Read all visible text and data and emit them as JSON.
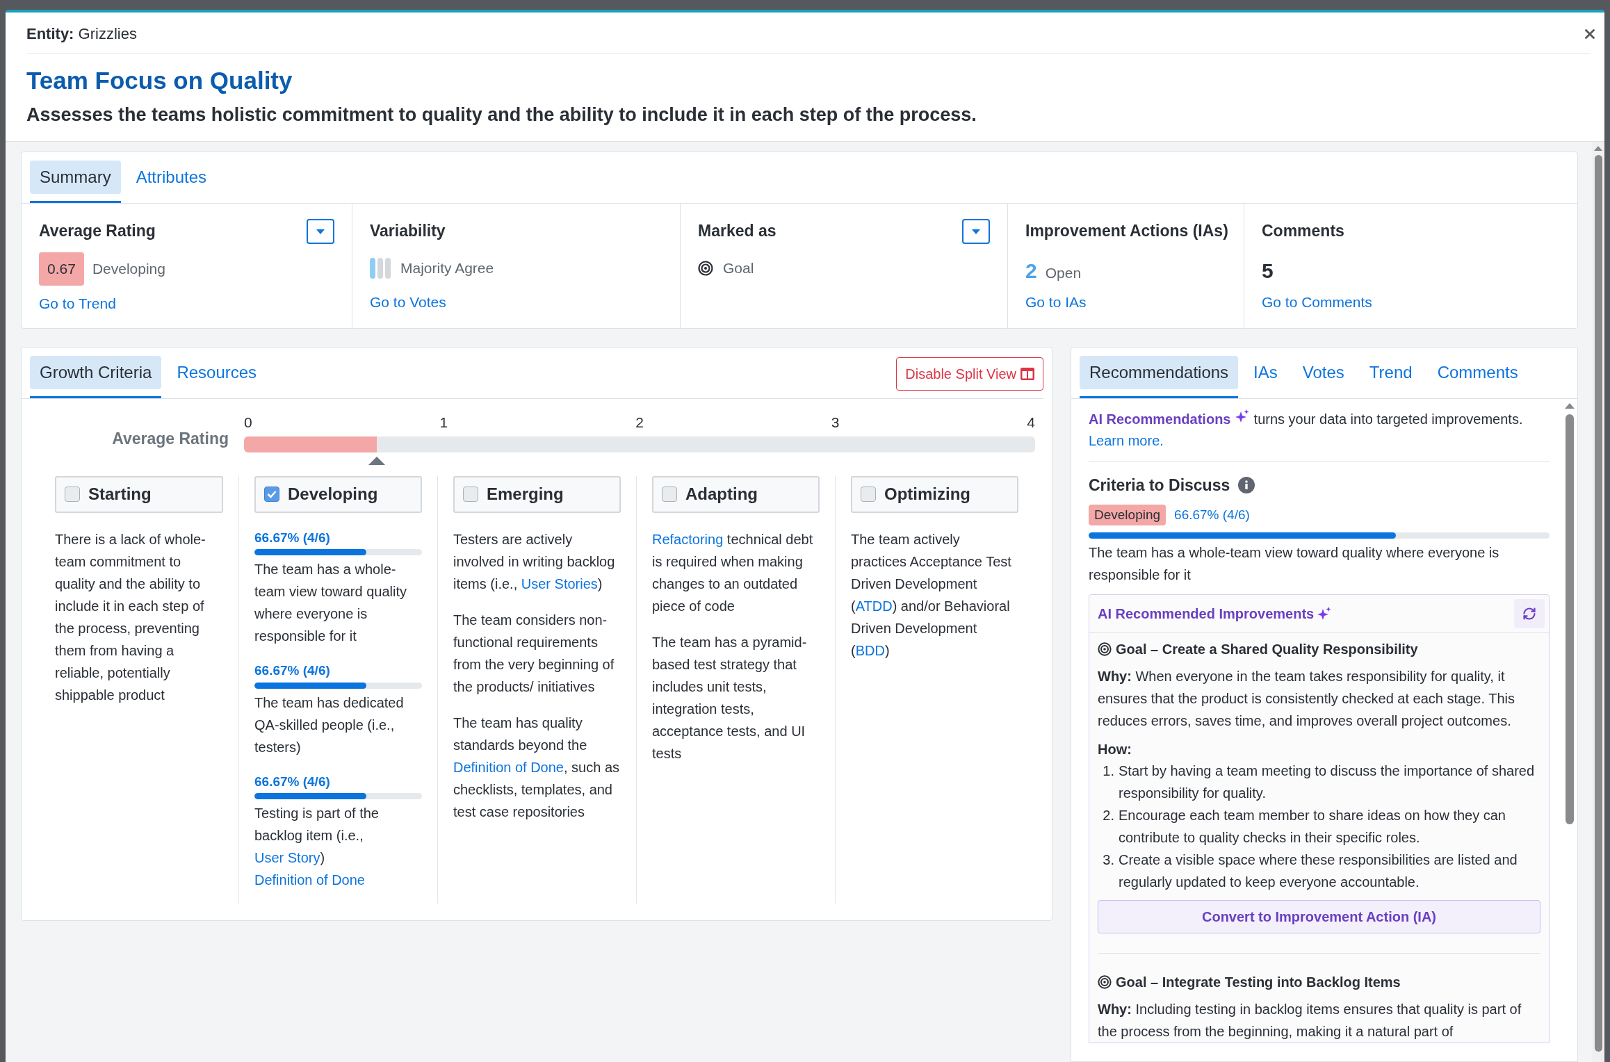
{
  "entity": {
    "label": "Entity:",
    "value": "Grizzlies"
  },
  "title": "Team Focus on Quality",
  "description": "Assesses the teams holistic commitment to quality and the ability to include it in each step of the process.",
  "summary_tabs": [
    {
      "label": "Summary",
      "selected": true
    },
    {
      "label": "Attributes",
      "selected": false
    }
  ],
  "summary_cards": [
    {
      "kind": "rating",
      "label": "Average Rating",
      "dropdown": true,
      "value": "0.67",
      "status": "Developing",
      "color": "#f4a7a7",
      "link": "Go to Trend"
    },
    {
      "kind": "variability",
      "label": "Variability",
      "dropdown": false,
      "status": "Majority Agree",
      "link": "Go to Votes"
    },
    {
      "kind": "marker",
      "label": "Marked as",
      "dropdown": true,
      "status": "Goal"
    },
    {
      "kind": "count",
      "label": "Improvement Actions (IAs)",
      "dropdown": false,
      "value": "2",
      "status": "Open",
      "link": "Go to IAs"
    },
    {
      "kind": "count",
      "label": "Comments",
      "dropdown": false,
      "value": "5",
      "link": "Go to Comments"
    }
  ],
  "growth_tabs": [
    {
      "label": "Growth Criteria",
      "selected": true
    },
    {
      "label": "Resources",
      "selected": false
    }
  ],
  "split_view_button": "Disable Split View",
  "rating_scale": {
    "label": "Average Rating",
    "ticks": [
      "0",
      "1",
      "2",
      "3",
      "4"
    ],
    "level": 0.1675
  },
  "levels": [
    {
      "name": "Starting",
      "checked": false,
      "criteria": [
        {
          "parts": [
            {
              "text": "There is a lack of whole-team commitment to quality and the ability to include it in each step of the process, preventing them from having a reliable, potentially shippable product",
              "link": false
            }
          ]
        }
      ]
    },
    {
      "name": "Developing",
      "checked": true,
      "criteria": [
        {
          "progress": {
            "label": "66.67% (4/6)",
            "level": 0.6667
          },
          "parts": [
            {
              "text": "The team has a whole-team view toward quality where everyone is responsible for it",
              "link": false
            }
          ]
        },
        {
          "progress": {
            "label": "66.67% (4/6)",
            "level": 0.6667
          },
          "parts": [
            {
              "text": "The team has dedicated QA-skilled people (i.e., testers)",
              "link": false
            }
          ]
        },
        {
          "progress": {
            "label": "66.67% (4/6)",
            "level": 0.6667
          },
          "parts": [
            {
              "text": "Testing is part of the backlog item (i.e., ",
              "link": false
            },
            {
              "text": "User Story",
              "link": true
            },
            {
              "text": ") ",
              "link": false
            },
            {
              "text": "Definition of Done",
              "link": true
            }
          ]
        }
      ]
    },
    {
      "name": "Emerging",
      "checked": false,
      "criteria": [
        {
          "parts": [
            {
              "text": "Testers are actively involved in writing backlog items (i.e., ",
              "link": false
            },
            {
              "text": "User Stories",
              "link": true
            },
            {
              "text": ")",
              "link": false
            }
          ]
        },
        {
          "parts": [
            {
              "text": "The team considers non-functional requirements from the very beginning of the products/ initiatives",
              "link": false
            }
          ]
        },
        {
          "parts": [
            {
              "text": "The team has quality standards beyond the ",
              "link": false
            },
            {
              "text": "Definition of Done",
              "link": true
            },
            {
              "text": ", such as checklists, templates, and test case repositories",
              "link": false
            }
          ]
        }
      ]
    },
    {
      "name": "Adapting",
      "checked": false,
      "criteria": [
        {
          "parts": [
            {
              "text": "Refactoring",
              "link": true
            },
            {
              "text": " technical debt is required when making changes to an outdated piece of code",
              "link": false
            }
          ]
        },
        {
          "parts": [
            {
              "text": "The team has a pyramid-based test strategy that includes unit tests, integration tests, acceptance tests, and UI tests",
              "link": false
            }
          ]
        }
      ]
    },
    {
      "name": "Optimizing",
      "checked": false,
      "criteria": [
        {
          "parts": [
            {
              "text": "The team actively practices Acceptance Test Driven Development (",
              "link": false
            },
            {
              "text": "ATDD",
              "link": true
            },
            {
              "text": ") and/or Behavioral Driven Development (",
              "link": false
            },
            {
              "text": "BDD",
              "link": true
            },
            {
              "text": ")",
              "link": false
            }
          ]
        }
      ]
    }
  ],
  "side_tabs": [
    {
      "label": "Recommendations",
      "selected": true
    },
    {
      "label": "IAs",
      "selected": false
    },
    {
      "label": "Votes",
      "selected": false
    },
    {
      "label": "Trend",
      "selected": false
    },
    {
      "label": "Comments",
      "selected": false
    }
  ],
  "intro": {
    "highlight": "AI Recommendations",
    "text": " turns your data into targeted improvements. ",
    "link": "Learn more."
  },
  "criteria_to_discuss": {
    "title": "Criteria to Discuss",
    "tag": "Developing",
    "color": "#f4a7a7",
    "progress": "66.67% (4/6)",
    "level": 0.6667,
    "text": "The team has a whole-team view toward quality where everyone is responsible for it"
  },
  "improvements": {
    "title": "AI Recommended Improvements",
    "goals": [
      {
        "title": "Goal – Create a Shared Quality Responsibility",
        "why_label": "Why:",
        "why": "When everyone in the team takes responsibility for quality, it ensures that the product is consistently checked at each stage. This reduces errors, saves time, and improves overall project outcomes.",
        "how_label": "How:",
        "steps": [
          {
            "number": "1.",
            "text": "Start by having a team meeting to discuss the importance of shared responsibility for quality."
          },
          {
            "number": "2.",
            "text": "Encourage each team member to share ideas on how they can contribute to quality checks in their specific roles."
          },
          {
            "number": "3.",
            "text": "Create a visible space where these responsibilities are listed and regularly updated to keep everyone accountable."
          }
        ],
        "button": "Convert to Improvement Action (IA)"
      },
      {
        "title": "Goal – Integrate Testing into Backlog Items",
        "why_label": "Why:",
        "why": "Including testing in backlog items ensures that quality is part of the process from the beginning, making it a natural part of"
      }
    ]
  }
}
